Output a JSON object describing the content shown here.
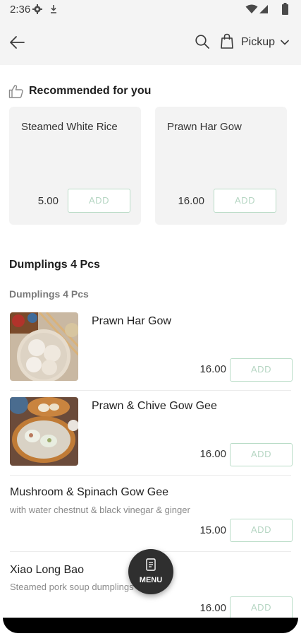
{
  "status_bar": {
    "time": "2:36",
    "icons": [
      "gear-icon",
      "download-icon",
      "wifi-icon",
      "signal-icon",
      "battery-icon"
    ]
  },
  "header": {
    "back_icon": "back-arrow-icon",
    "search_icon": "search-icon",
    "bag_icon": "shopping-bag-icon",
    "order_mode": "Pickup",
    "chevron_icon": "chevron-down-icon"
  },
  "recommended": {
    "title": "Recommended for you",
    "icon": "thumbs-up-icon",
    "cards": [
      {
        "name": "Steamed White Rice",
        "price": "5.00",
        "add_label": "ADD"
      },
      {
        "name": "Prawn Har Gow",
        "price": "16.00",
        "add_label": "ADD"
      }
    ]
  },
  "category": {
    "title": "Dumplings 4 Pcs",
    "subtitle": "Dumplings 4 Pcs",
    "items": [
      {
        "name": "Prawn Har Gow",
        "description": "",
        "price": "16.00",
        "add_label": "ADD",
        "has_photo": true
      },
      {
        "name": "Prawn & Chive Gow Gee",
        "description": "",
        "price": "16.00",
        "add_label": "ADD",
        "has_photo": true
      },
      {
        "name": "Mushroom & Spinach Gow Gee",
        "description": "with water chestnut & black vinegar & ginger",
        "price": "15.00",
        "add_label": "ADD",
        "has_photo": false
      },
      {
        "name": "Xiao Long Bao",
        "description": "Steamed pork soup dumplings",
        "price": "16.00",
        "add_label": "ADD",
        "has_photo": false
      }
    ]
  },
  "fab": {
    "label": "MENU",
    "icon": "menu-document-icon"
  },
  "colors": {
    "accent_border": "#b9dcc7",
    "accent_text": "#b6d6c3",
    "card_bg": "#f3f3f3",
    "header_bg": "#f4f4f4",
    "fab_bg": "#2f2f2f"
  }
}
